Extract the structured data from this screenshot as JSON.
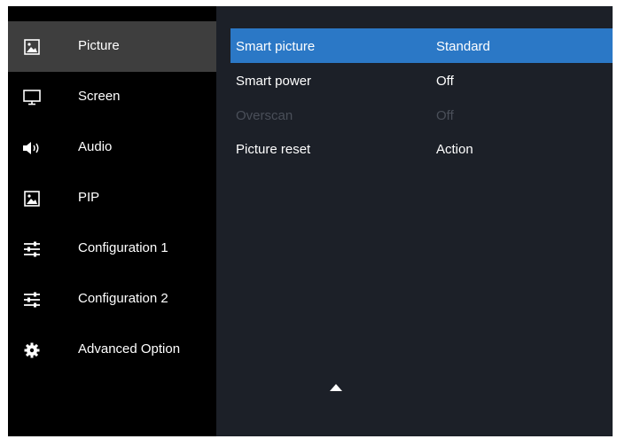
{
  "sidebar": {
    "items": [
      {
        "label": "Picture",
        "icon": "picture-icon",
        "active": true
      },
      {
        "label": "Screen",
        "icon": "monitor-icon",
        "active": false
      },
      {
        "label": "Audio",
        "icon": "speaker-icon",
        "active": false
      },
      {
        "label": "PIP",
        "icon": "picture-icon",
        "active": false
      },
      {
        "label": "Configuration 1",
        "icon": "sliders-icon",
        "active": false
      },
      {
        "label": "Configuration 2",
        "icon": "sliders-icon",
        "active": false
      },
      {
        "label": "Advanced Option",
        "icon": "gear-icon",
        "active": false
      }
    ]
  },
  "menu": {
    "rows": [
      {
        "label": "Smart picture",
        "value": "Standard",
        "selected": true,
        "enabled": true
      },
      {
        "label": "Smart power",
        "value": "Off",
        "selected": false,
        "enabled": true
      },
      {
        "label": "Overscan",
        "value": "Off",
        "selected": false,
        "enabled": false
      },
      {
        "label": "Picture reset",
        "value": "Action",
        "selected": false,
        "enabled": true
      }
    ],
    "scroll_indicator": "up-arrow-icon"
  },
  "colors": {
    "sidebar_bg": "#000000",
    "sidebar_active": "#3e3e3e",
    "panel_bg": "#1c2028",
    "highlight": "#2b78c6",
    "disabled_text": "#4a4f59"
  }
}
